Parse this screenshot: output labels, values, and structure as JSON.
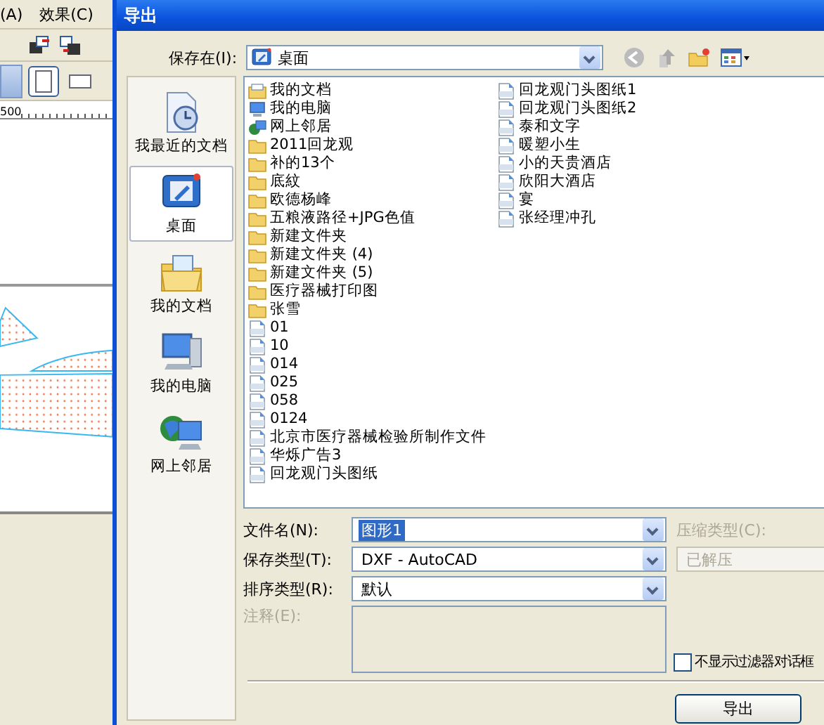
{
  "background_app": {
    "menu": [
      "(A)",
      "效果(C)"
    ],
    "ruler_label": "500"
  },
  "dialog": {
    "title": "导出",
    "save_in": {
      "label": "保存在(I):",
      "value": "桌面"
    },
    "places": [
      {
        "label": "我最近的文档",
        "kind": "recent",
        "selected": false
      },
      {
        "label": "桌面",
        "kind": "desktop",
        "selected": true
      },
      {
        "label": "我的文档",
        "kind": "documents",
        "selected": false
      },
      {
        "label": "我的电脑",
        "kind": "computer",
        "selected": false
      },
      {
        "label": "网上邻居",
        "kind": "network",
        "selected": false
      }
    ],
    "files": [
      {
        "name": "我的文档",
        "kind": "documents"
      },
      {
        "name": "我的电脑",
        "kind": "computer"
      },
      {
        "name": "网上邻居",
        "kind": "network"
      },
      {
        "name": "2011回龙观",
        "kind": "folder"
      },
      {
        "name": "补的13个",
        "kind": "folder"
      },
      {
        "name": "底紋",
        "kind": "folder"
      },
      {
        "name": "欧德杨峰",
        "kind": "folder"
      },
      {
        "name": "五粮液路径+JPG色值",
        "kind": "folder"
      },
      {
        "name": "新建文件夹",
        "kind": "folder"
      },
      {
        "name": "新建文件夹 (4)",
        "kind": "folder"
      },
      {
        "name": "新建文件夹 (5)",
        "kind": "folder"
      },
      {
        "name": "医疗器械打印图",
        "kind": "folder"
      },
      {
        "name": "张雪",
        "kind": "folder"
      },
      {
        "name": "01",
        "kind": "dxf"
      },
      {
        "name": "10",
        "kind": "dxf"
      },
      {
        "name": "014",
        "kind": "dxf"
      },
      {
        "name": "025",
        "kind": "dxf"
      },
      {
        "name": "058",
        "kind": "dxf"
      },
      {
        "name": "0124",
        "kind": "dxf"
      },
      {
        "name": "北京市医疗器械检验所制作文件",
        "kind": "dxf"
      },
      {
        "name": "华烁广告3",
        "kind": "dxf"
      },
      {
        "name": "回龙观门头图纸",
        "kind": "dxf"
      },
      {
        "name": "回龙观门头图纸1",
        "kind": "dxf"
      },
      {
        "name": "回龙观门头图纸2",
        "kind": "dxf"
      },
      {
        "name": "泰和文字",
        "kind": "dxf"
      },
      {
        "name": "暖塑小生",
        "kind": "dxf"
      },
      {
        "name": "小的天贵酒店",
        "kind": "dxf"
      },
      {
        "name": "欣阳大酒店",
        "kind": "dxf"
      },
      {
        "name": "宴",
        "kind": "dxf"
      },
      {
        "name": "张经理冲孔",
        "kind": "dxf"
      }
    ],
    "file_name": {
      "label": "文件名(N):",
      "value": "图形1",
      "selected": true
    },
    "save_type": {
      "label": "保存类型(T):",
      "value": "DXF - AutoCAD"
    },
    "sort_type": {
      "label": "排序类型(R):",
      "value": "默认"
    },
    "notes": {
      "label": "注释(E):",
      "disabled": true
    },
    "compression": {
      "label": "压缩类型(C):",
      "value": "已解压",
      "disabled": true
    },
    "hide_filter_dialog": {
      "label": "不显示过滤器对话框",
      "checked": false
    },
    "export_button": "导出"
  }
}
